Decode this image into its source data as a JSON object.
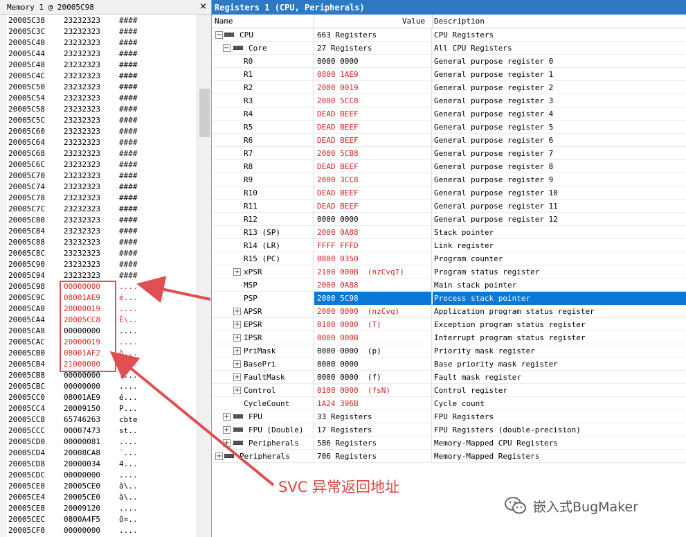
{
  "memory": {
    "title": "Memory 1 @ 20005C98",
    "close_glyph": "×",
    "rows": [
      {
        "addr": "20005C38",
        "value": "23232323",
        "ascii": "####"
      },
      {
        "addr": "20005C3C",
        "value": "23232323",
        "ascii": "####"
      },
      {
        "addr": "20005C40",
        "value": "23232323",
        "ascii": "####"
      },
      {
        "addr": "20005C44",
        "value": "23232323",
        "ascii": "####"
      },
      {
        "addr": "20005C48",
        "value": "23232323",
        "ascii": "####"
      },
      {
        "addr": "20005C4C",
        "value": "23232323",
        "ascii": "####"
      },
      {
        "addr": "20005C50",
        "value": "23232323",
        "ascii": "####"
      },
      {
        "addr": "20005C54",
        "value": "23232323",
        "ascii": "####"
      },
      {
        "addr": "20005C58",
        "value": "23232323",
        "ascii": "####"
      },
      {
        "addr": "20005C5C",
        "value": "23232323",
        "ascii": "####"
      },
      {
        "addr": "20005C60",
        "value": "23232323",
        "ascii": "####"
      },
      {
        "addr": "20005C64",
        "value": "23232323",
        "ascii": "####"
      },
      {
        "addr": "20005C68",
        "value": "23232323",
        "ascii": "####"
      },
      {
        "addr": "20005C6C",
        "value": "23232323",
        "ascii": "####"
      },
      {
        "addr": "20005C70",
        "value": "23232323",
        "ascii": "####"
      },
      {
        "addr": "20005C74",
        "value": "23232323",
        "ascii": "####"
      },
      {
        "addr": "20005C78",
        "value": "23232323",
        "ascii": "####"
      },
      {
        "addr": "20005C7C",
        "value": "23232323",
        "ascii": "####"
      },
      {
        "addr": "20005C80",
        "value": "23232323",
        "ascii": "####"
      },
      {
        "addr": "20005C84",
        "value": "23232323",
        "ascii": "####"
      },
      {
        "addr": "20005C88",
        "value": "23232323",
        "ascii": "####"
      },
      {
        "addr": "20005C8C",
        "value": "23232323",
        "ascii": "####"
      },
      {
        "addr": "20005C90",
        "value": "23232323",
        "ascii": "####"
      },
      {
        "addr": "20005C94",
        "value": "23232323",
        "ascii": "####"
      },
      {
        "addr": "20005C98",
        "value": "00000000",
        "ascii": "....",
        "highlight": true
      },
      {
        "addr": "20005C9C",
        "value": "08001AE9",
        "ascii": "é...",
        "highlight": true
      },
      {
        "addr": "20005CA0",
        "value": "20000019",
        "ascii": "....",
        "highlight": true
      },
      {
        "addr": "20005CA4",
        "value": "20005CC8",
        "ascii": "È\\..",
        "highlight": true
      },
      {
        "addr": "20005CA8",
        "value": "00000000",
        "ascii": "....",
        "highlight": false
      },
      {
        "addr": "20005CAC",
        "value": "20000019",
        "ascii": "....",
        "highlight": true
      },
      {
        "addr": "20005CB0",
        "value": "08001AF2",
        "ascii": "ò...",
        "highlight": true
      },
      {
        "addr": "20005CB4",
        "value": "21000000",
        "ascii": "...!",
        "highlight": true
      },
      {
        "addr": "20005CB8",
        "value": "00000000",
        "ascii": "...."
      },
      {
        "addr": "20005CBC",
        "value": "00000000",
        "ascii": "...."
      },
      {
        "addr": "20005CC0",
        "value": "08001AE9",
        "ascii": "é..."
      },
      {
        "addr": "20005CC4",
        "value": "20009150",
        "ascii": "P..."
      },
      {
        "addr": "20005CC8",
        "value": "65746263",
        "ascii": "cbte"
      },
      {
        "addr": "20005CCC",
        "value": "00007473",
        "ascii": "st.."
      },
      {
        "addr": "20005CD0",
        "value": "00000081",
        "ascii": "...."
      },
      {
        "addr": "20005CD4",
        "value": "20008CA8",
        "ascii": "¨..."
      },
      {
        "addr": "20005CD8",
        "value": "20000034",
        "ascii": "4..."
      },
      {
        "addr": "20005CDC",
        "value": "00000000",
        "ascii": "...."
      },
      {
        "addr": "20005CE0",
        "value": "20005CE0",
        "ascii": "à\\.."
      },
      {
        "addr": "20005CE4",
        "value": "20005CE0",
        "ascii": "à\\.."
      },
      {
        "addr": "20005CE8",
        "value": "20009120",
        "ascii": "...."
      },
      {
        "addr": "20005CEC",
        "value": "0800A4F5",
        "ascii": "õ¤.."
      },
      {
        "addr": "20005CF0",
        "value": "00000000",
        "ascii": "...."
      }
    ]
  },
  "registers": {
    "title": "Registers 1 (CPU, Peripherals)",
    "columns": {
      "name": "Name",
      "value": "Value",
      "description": "Description"
    },
    "rows": [
      {
        "level": 0,
        "expander": "−",
        "icon": "chip-icon",
        "name": "CPU",
        "value": "663 Registers",
        "desc": "CPU Registers"
      },
      {
        "level": 1,
        "expander": "−",
        "icon": "chip-icon",
        "name": "Core",
        "value": "27 Registers",
        "desc": "All CPU Registers"
      },
      {
        "level": 2,
        "name": "R0",
        "value": "0000 0000",
        "desc": "General purpose register 0"
      },
      {
        "level": 2,
        "name": "R1",
        "value": "0800 1AE9",
        "desc": "General purpose register 1",
        "red": true
      },
      {
        "level": 2,
        "name": "R2",
        "value": "2000 0019",
        "desc": "General purpose register 2",
        "red": true
      },
      {
        "level": 2,
        "name": "R3",
        "value": "2000 5CC8",
        "desc": "General purpose register 3",
        "red": true
      },
      {
        "level": 2,
        "name": "R4",
        "value": "DEAD BEEF",
        "desc": "General purpose register 4",
        "red": true
      },
      {
        "level": 2,
        "name": "R5",
        "value": "DEAD BEEF",
        "desc": "General purpose register 5",
        "red": true
      },
      {
        "level": 2,
        "name": "R6",
        "value": "DEAD BEEF",
        "desc": "General purpose register 6",
        "red": true
      },
      {
        "level": 2,
        "name": "R7",
        "value": "2000 5CB8",
        "desc": "General purpose register 7",
        "red": true
      },
      {
        "level": 2,
        "name": "R8",
        "value": "DEAD BEEF",
        "desc": "General purpose register 8",
        "red": true
      },
      {
        "level": 2,
        "name": "R9",
        "value": "2000 3CC8",
        "desc": "General purpose register 9",
        "red": true
      },
      {
        "level": 2,
        "name": "R10",
        "value": "DEAD BEEF",
        "desc": "General purpose register 10",
        "red": true
      },
      {
        "level": 2,
        "name": "R11",
        "value": "DEAD BEEF",
        "desc": "General purpose register 11",
        "red": true
      },
      {
        "level": 2,
        "name": "R12",
        "value": "0000 0000",
        "desc": "General purpose register 12"
      },
      {
        "level": 2,
        "name": "R13 (SP)",
        "value": "2000 0A88",
        "desc": "Stack pointer",
        "red": true
      },
      {
        "level": 2,
        "name": "R14 (LR)",
        "value": "FFFF FFFD",
        "desc": "Link register",
        "red": true
      },
      {
        "level": 2,
        "name": "R15 (PC)",
        "value": "0800 0350",
        "desc": "Program counter",
        "red": true
      },
      {
        "level": 2,
        "expander": "+",
        "name": "xPSR",
        "value": "2100 000B  (nzCvqT)",
        "desc": "Program status register",
        "red": true
      },
      {
        "level": 2,
        "name": "MSP",
        "value": "2000 0A88",
        "desc": "Main stack pointer",
        "red": true
      },
      {
        "level": 2,
        "name": "PSP",
        "value": "2000 5C98",
        "desc": "Process stack pointer",
        "red": true,
        "selected": true
      },
      {
        "level": 2,
        "expander": "+",
        "name": "APSR",
        "value": "2000 0000  (nzCvq)",
        "desc": "Application program status register",
        "red": true
      },
      {
        "level": 2,
        "expander": "+",
        "name": "EPSR",
        "value": "0100 0000  (T)",
        "desc": "Exception program status register",
        "red": true
      },
      {
        "level": 2,
        "expander": "+",
        "name": "IPSR",
        "value": "0000 000B",
        "desc": "Interrupt program status register",
        "red": true
      },
      {
        "level": 2,
        "expander": "+",
        "name": "PriMask",
        "value": "0000 0000  (p)",
        "desc": "Priority mask register"
      },
      {
        "level": 2,
        "expander": "+",
        "name": "BasePri",
        "value": "0000 0000",
        "desc": "Base priority mask register"
      },
      {
        "level": 2,
        "expander": "+",
        "name": "FaultMask",
        "value": "0000 0000  (f)",
        "desc": "Fault mask register"
      },
      {
        "level": 2,
        "expander": "+",
        "name": "Control",
        "value": "0100 0000  (fsN)",
        "desc": "Control register",
        "red": true
      },
      {
        "level": 2,
        "name": "CycleCount",
        "value": "1A24 396B",
        "desc": "Cycle count",
        "red": true
      },
      {
        "level": 1,
        "expander": "+",
        "icon": "chip-icon",
        "name": "FPU",
        "value": "33 Registers",
        "desc": "FPU Registers"
      },
      {
        "level": 1,
        "expander": "+",
        "icon": "chip-icon",
        "name": "FPU (Double)",
        "value": "17 Registers",
        "desc": "FPU Registers (double-precision)"
      },
      {
        "level": 1,
        "expander": "+",
        "icon": "chip-icon",
        "name": "Peripherals",
        "value": "586 Registers",
        "desc": "Memory-Mapped CPU Registers"
      },
      {
        "level": 0,
        "expander": "+",
        "icon": "chip-icon",
        "name": "Peripherals",
        "value": "706 Registers",
        "desc": "Memory-Mapped Registers"
      }
    ]
  },
  "annotation": {
    "label": "SVC 异常返回地址",
    "color": "#e14444"
  },
  "watermark": {
    "icon": "wechat-icon",
    "text": "嵌入式BugMaker"
  },
  "colors": {
    "accent": "#2e79c6",
    "selection": "#0a78d7",
    "changed_value": "#d42020"
  }
}
